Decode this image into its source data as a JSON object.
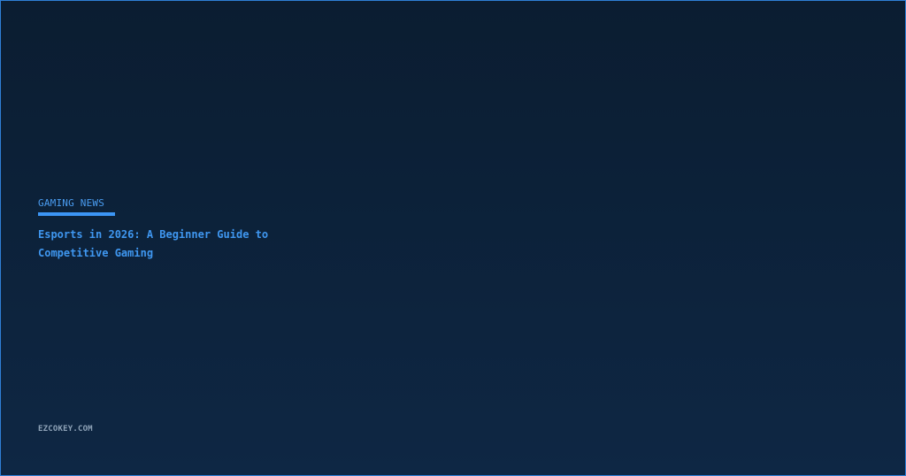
{
  "category": "GAMING NEWS",
  "headline": "Esports in 2026: A Beginner Guide to Competitive Gaming",
  "site": "EZCOKEY.COM",
  "colors": {
    "accent": "#3c96f5",
    "background_top": "#0b1d31",
    "background_bottom": "#0e2744",
    "site_text": "#8fa3b8"
  }
}
